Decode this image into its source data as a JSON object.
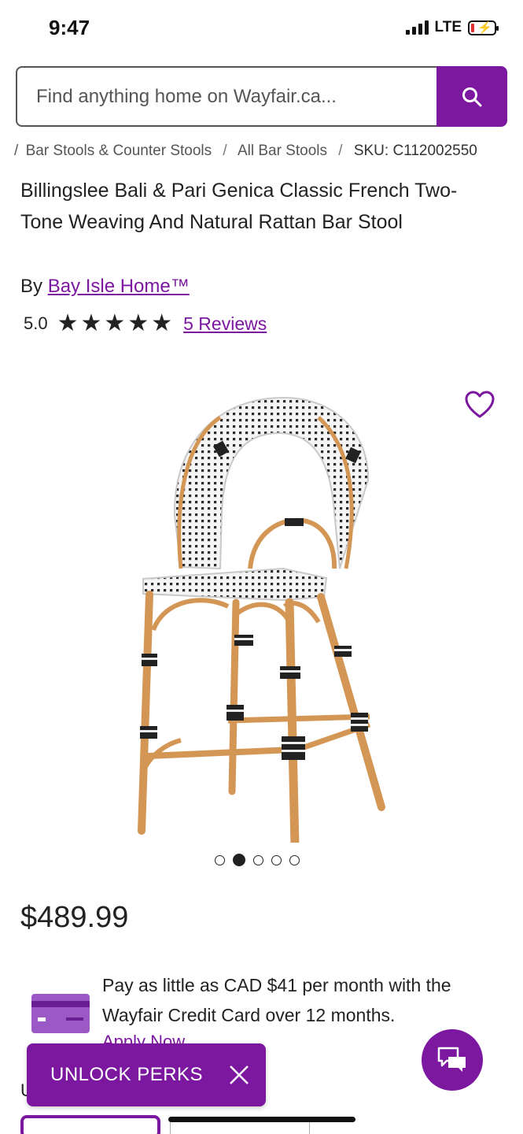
{
  "status_bar": {
    "time": "9:47",
    "network": "LTE"
  },
  "search": {
    "placeholder": "Find anything home on Wayfair.ca..."
  },
  "breadcrumb": {
    "lead_sep": "/",
    "items": [
      "Bar Stools & Counter Stools",
      "All Bar Stools"
    ],
    "sep": "/",
    "sku": "SKU: C112002550"
  },
  "product": {
    "title": "Billingslee Bali & Pari Genica Classic French Two-Tone Weaving And Natural Rattan Bar Stool",
    "by_label": "By",
    "brand": "Bay Isle Home™",
    "rating_value": "5.0",
    "rating_stars": 5,
    "reviews_label": "5 Reviews",
    "image_count": 5,
    "active_image": 2,
    "price": "$489.99"
  },
  "financing": {
    "text": "Pay as little as CAD $41 per month with the Wayfair Credit Card over 12 months.",
    "apply_label": "Apply Now"
  },
  "promo": {
    "unlock_label": "UNLOCK PERKS"
  },
  "partial_section_letter": "U",
  "colors": {
    "brand_purple": "#7b189f",
    "text": "#222222",
    "battery_low": "#e0322d"
  },
  "icons": [
    "search-icon",
    "heart-icon",
    "close-icon",
    "chat-icon",
    "credit-card-icon",
    "star-icon"
  ]
}
